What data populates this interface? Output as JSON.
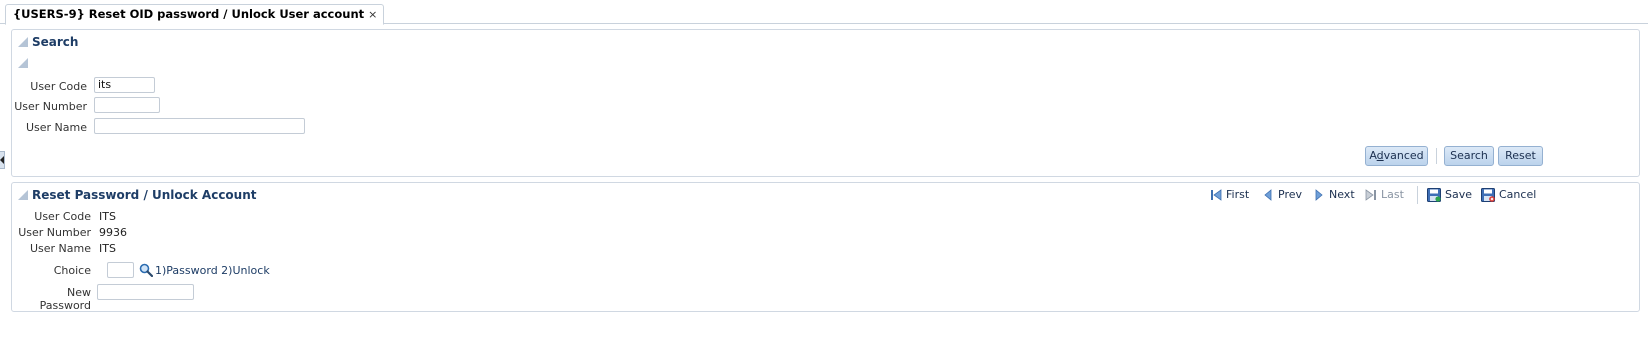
{
  "tab": {
    "title": "{USERS-9} Reset OID password / Unlock User account",
    "close_glyph": "×"
  },
  "search_panel": {
    "title": "Search",
    "fields": [
      {
        "label": "User Code",
        "value": "its"
      },
      {
        "label": "User Number",
        "value": ""
      },
      {
        "label": "User Name",
        "value": ""
      }
    ],
    "buttons": {
      "advanced": "Advanced",
      "search": "Search",
      "reset": "Reset"
    }
  },
  "reset_panel": {
    "title": "Reset Password / Unlock Account",
    "nav": {
      "first": "First",
      "prev": "Prev",
      "next": "Next",
      "last": "Last",
      "save": "Save",
      "cancel": "Cancel"
    },
    "fields": [
      {
        "label": "User Code",
        "value": "ITS"
      },
      {
        "label": "User Number",
        "value": "9936"
      },
      {
        "label": "User Name",
        "value": "ITS"
      }
    ],
    "choice": {
      "label": "Choice",
      "value": "",
      "hint": "1)Password 2)Unlock"
    },
    "new_password": {
      "label": "New Password",
      "value": ""
    }
  },
  "colors": {
    "accent": "#1e3d66",
    "button_bg": "#bcd3ec",
    "border": "#d0d8e2"
  },
  "icons": [
    "close-icon",
    "disclosure-icon",
    "first-icon",
    "prev-icon",
    "next-icon",
    "last-icon",
    "save-icon",
    "cancel-icon",
    "search-lov-icon",
    "collapse-handle-icon"
  ]
}
